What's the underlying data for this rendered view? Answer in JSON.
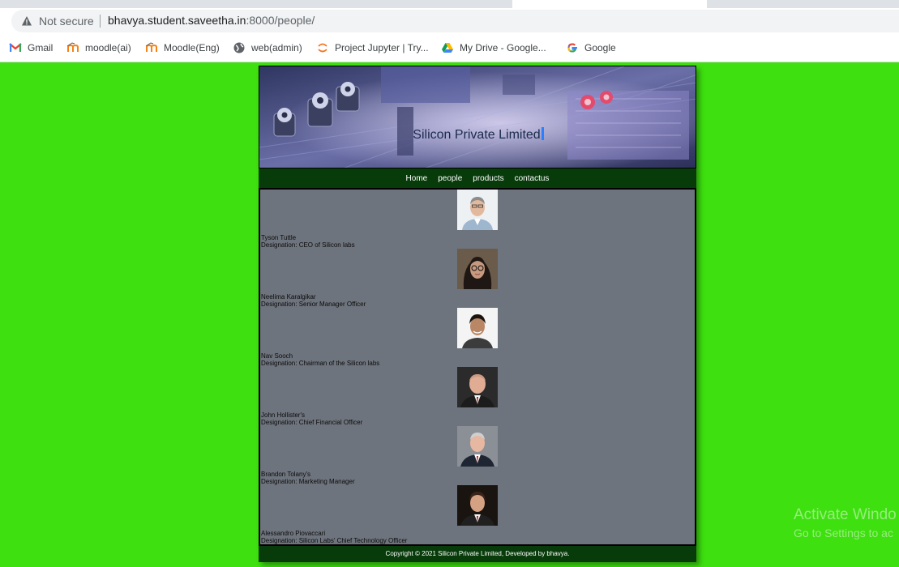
{
  "browser": {
    "security_label": "Not secure",
    "url_host": "bhavya.student.saveetha.in",
    "url_path": ":8000/people/"
  },
  "bookmarks": [
    {
      "label": "Gmail",
      "icon": "gmail-icon"
    },
    {
      "label": "moodle(ai)",
      "icon": "moodle-icon"
    },
    {
      "label": "Moodle(Eng)",
      "icon": "moodle-icon"
    },
    {
      "label": "web(admin)",
      "icon": "globe-icon"
    },
    {
      "label": "Project Jupyter | Try...",
      "icon": "jupyter-icon"
    },
    {
      "label": "My Drive - Google...",
      "icon": "google-drive-icon"
    },
    {
      "label": "Google",
      "icon": "google-icon"
    }
  ],
  "site": {
    "company_name": "Silicon Private Limited",
    "nav": [
      "Home",
      "people",
      "products",
      "contactus"
    ],
    "footer": "Copyright © 2021 Silicon Private Limited, Developed by bhavya."
  },
  "people": [
    {
      "name": "Tyson Tuttle",
      "designation": "Designation: CEO of Silicon labs"
    },
    {
      "name": "Neelima Karalgikar",
      "designation": "Designation: Senior Manager Officer"
    },
    {
      "name": "Nav Sooch",
      "designation": "Designation: Chairman of the Silicon labs"
    },
    {
      "name": "John Hollister's",
      "designation": "Designation: Chief Financial Officer"
    },
    {
      "name": "Brandon Tolany's",
      "designation": "Designation: Marketing Manager"
    },
    {
      "name": "Alessandro Piovaccari",
      "designation": "Designation: Silicon Labs' Chief Technology Officer"
    }
  ],
  "windows_watermark": {
    "line1": "Activate Windo",
    "line2": "Go to Settings to ac"
  },
  "colors": {
    "page_background": "#3ee00f",
    "nav_background": "#073b0a",
    "content_background": "#6e747d"
  }
}
